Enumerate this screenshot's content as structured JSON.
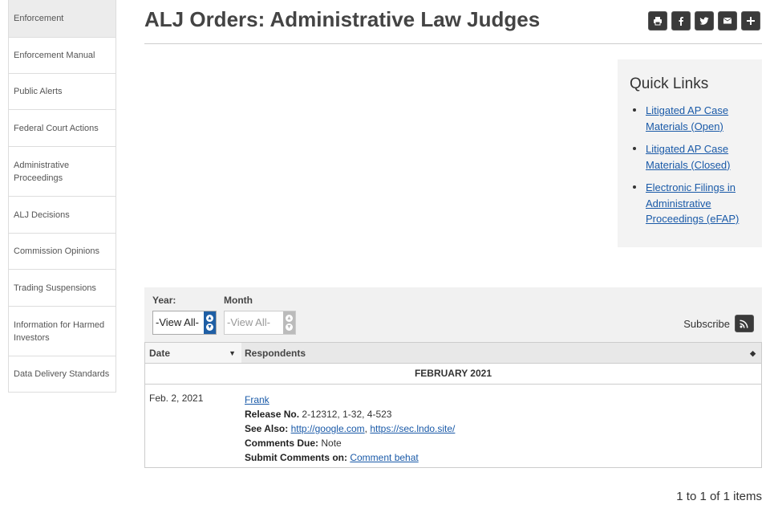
{
  "sidebar": {
    "items": [
      {
        "label": "Enforcement",
        "height": 46
      },
      {
        "label": "Enforcement Manual",
        "height": 45
      },
      {
        "label": "Public Alerts",
        "height": 45
      },
      {
        "label": "Federal Court Actions",
        "height": 46
      },
      {
        "label": "Administrative Proceedings",
        "height": 62
      },
      {
        "label": "ALJ Decisions",
        "height": 46
      },
      {
        "label": "Commission Opinions",
        "height": 45
      },
      {
        "label": "Trading Suspensions",
        "height": 46
      },
      {
        "label": "Information for Harmed Investors",
        "height": 62
      },
      {
        "label": "Data Delivery Standards",
        "height": 45
      }
    ]
  },
  "header": {
    "title": "ALJ Orders: Administrative Law Judges",
    "share_icons": [
      "print-icon",
      "facebook-icon",
      "twitter-icon",
      "email-icon",
      "plus-icon"
    ]
  },
  "quick_links": {
    "title": "Quick Links",
    "links": [
      "Litigated AP Case Materials (Open)",
      "Litigated AP Case Materials (Closed)",
      "Electronic Filings in Administrative Proceedings (eFAP)"
    ]
  },
  "filters": {
    "year_label": "Year:",
    "year_value": "-View All-",
    "month_label": "Month",
    "month_value": "-View All-",
    "subscribe_label": "Subscribe"
  },
  "table": {
    "columns": [
      "Date",
      "Respondents"
    ],
    "group_label": "FEBRUARY 2021",
    "rows": [
      {
        "date": "Feb. 2, 2021",
        "respondent": "Frank",
        "release_label": "Release No.",
        "release_value": "2-12312, 1-32, 4-523",
        "see_also_label": "See Also:",
        "see_also_links": [
          "http://google.com",
          "https://sec.lndo.site/"
        ],
        "comments_due_label": "Comments Due:",
        "comments_due_value": "Note",
        "submit_label": "Submit Comments on:",
        "submit_link": "Comment behat"
      }
    ]
  },
  "pager": {
    "text": "1 to 1 of 1 items"
  }
}
